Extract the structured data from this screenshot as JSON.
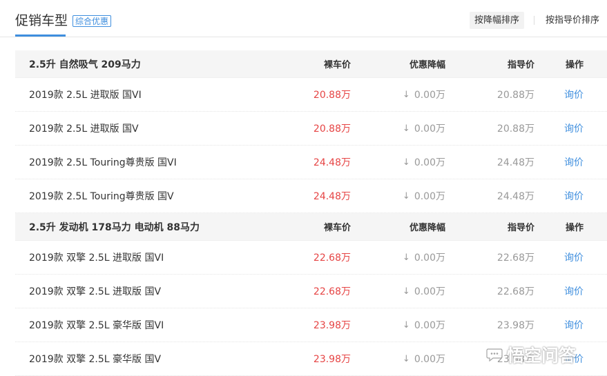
{
  "header": {
    "title": "促销车型",
    "badge": "综合优惠",
    "sort_by_discount": "按降幅排序",
    "sort_by_guide": "按指导价排序"
  },
  "colors": {
    "accent": "#3e8ede",
    "price_red": "#e64444",
    "muted": "#999999"
  },
  "groups": [
    {
      "name": "2.5升 自然吸气 209马力",
      "col_price": "裸车价",
      "col_discount": "优惠降幅",
      "col_guide": "指导价",
      "col_action": "操作",
      "rows": [
        {
          "name": "2019款 2.5L 进取版 国VI",
          "price": "20.88万",
          "discount": "0.00万",
          "guide": "20.88万",
          "action": "询价"
        },
        {
          "name": "2019款 2.5L 进取版 国V",
          "price": "20.88万",
          "discount": "0.00万",
          "guide": "20.88万",
          "action": "询价"
        },
        {
          "name": "2019款 2.5L Touring尊贵版 国VI",
          "price": "24.48万",
          "discount": "0.00万",
          "guide": "24.48万",
          "action": "询价"
        },
        {
          "name": "2019款 2.5L Touring尊贵版 国V",
          "price": "24.48万",
          "discount": "0.00万",
          "guide": "24.48万",
          "action": "询价"
        }
      ]
    },
    {
      "name": "2.5升 发动机 178马力 电动机 88马力",
      "col_price": "裸车价",
      "col_discount": "优惠降幅",
      "col_guide": "指导价",
      "col_action": "操作",
      "rows": [
        {
          "name": "2019款 双擎 2.5L 进取版 国VI",
          "price": "22.68万",
          "discount": "0.00万",
          "guide": "22.68万",
          "action": "询价"
        },
        {
          "name": "2019款 双擎 2.5L 进取版 国V",
          "price": "22.68万",
          "discount": "0.00万",
          "guide": "22.68万",
          "action": "询价"
        },
        {
          "name": "2019款 双擎 2.5L 豪华版 国VI",
          "price": "23.98万",
          "discount": "0.00万",
          "guide": "23.98万",
          "action": "询价"
        },
        {
          "name": "2019款 双擎 2.5L 豪华版 国V",
          "price": "23.98万",
          "discount": "0.00万",
          "guide": "23.98万",
          "action": "询价"
        }
      ]
    }
  ],
  "watermark": {
    "text": "悟空问答",
    "icon": "chat-bubble-icon"
  }
}
